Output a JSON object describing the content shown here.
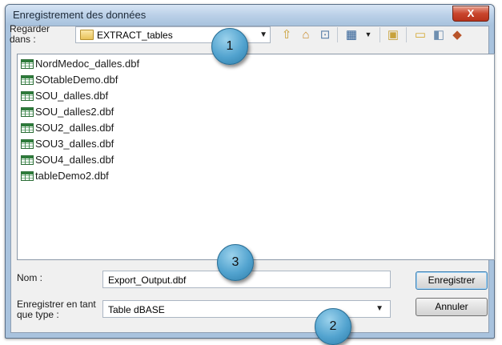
{
  "window": {
    "title": "Enregistrement des données",
    "close_label": "X"
  },
  "lookin": {
    "label": "Regarder dans :",
    "folder": "EXTRACT_tables"
  },
  "toolbar": {
    "icons": [
      "up-folder-icon",
      "home-icon",
      "connect-icon",
      "view-list-icon",
      "new-folder-icon",
      "folder-icon",
      "catalog-icon",
      "geodatabase-icon"
    ]
  },
  "files": [
    "NordMedoc_dalles.dbf",
    "SOtableDemo.dbf",
    "SOU_dalles.dbf",
    "SOU_dalles2.dbf",
    "SOU2_dalles.dbf",
    "SOU3_dalles.dbf",
    "SOU4_dalles.dbf",
    "tableDemo2.dbf"
  ],
  "name": {
    "label": "Nom :",
    "value": "Export_Output.dbf"
  },
  "type": {
    "label": "Enregistrer en tant que type :",
    "value": "Table dBASE"
  },
  "buttons": {
    "save": "Enregistrer",
    "cancel": "Annuler"
  },
  "callouts": [
    "1",
    "2",
    "3"
  ]
}
